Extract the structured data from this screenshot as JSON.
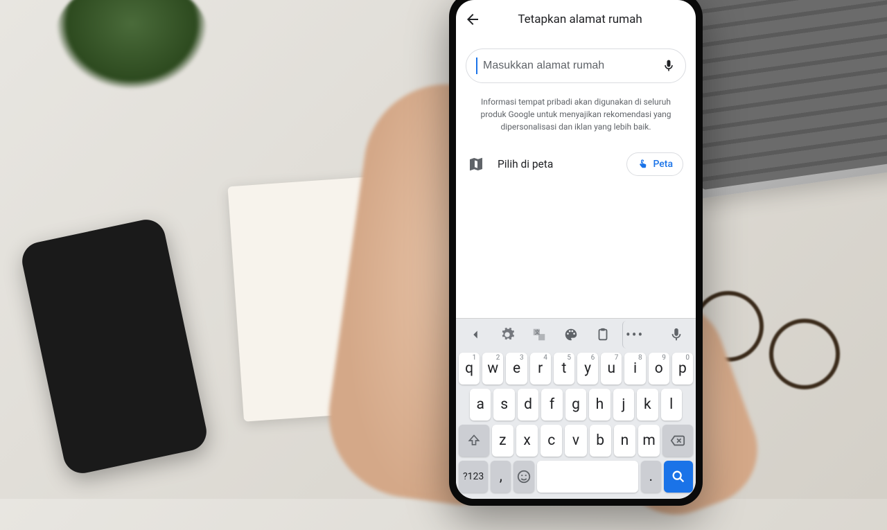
{
  "header": {
    "title": "Tetapkan alamat rumah"
  },
  "search": {
    "placeholder": "Masukkan alamat rumah",
    "value": ""
  },
  "info_text": "Informasi tempat pribadi akan digunakan di seluruh produk Google untuk menyajikan rekomendasi yang dipersonalisasi dan iklan yang lebih baik.",
  "map_row": {
    "label": "Pilih di peta",
    "chip": "Peta"
  },
  "keyboard": {
    "row1": [
      {
        "k": "q",
        "n": "1"
      },
      {
        "k": "w",
        "n": "2"
      },
      {
        "k": "e",
        "n": "3"
      },
      {
        "k": "r",
        "n": "4"
      },
      {
        "k": "t",
        "n": "5"
      },
      {
        "k": "y",
        "n": "6"
      },
      {
        "k": "u",
        "n": "7"
      },
      {
        "k": "i",
        "n": "8"
      },
      {
        "k": "o",
        "n": "9"
      },
      {
        "k": "p",
        "n": "0"
      }
    ],
    "row2": [
      "a",
      "s",
      "d",
      "f",
      "g",
      "h",
      "j",
      "k",
      "l"
    ],
    "row3": [
      "z",
      "x",
      "c",
      "v",
      "b",
      "n",
      "m"
    ],
    "sym_label": "?123",
    "comma": ",",
    "period": "."
  }
}
